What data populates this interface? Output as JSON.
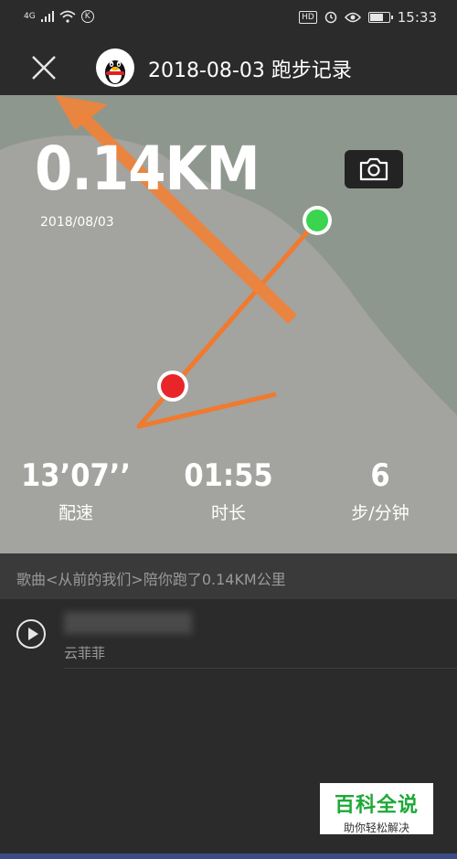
{
  "status": {
    "network": "4G",
    "k_badge": "K",
    "hd": "HD",
    "time": "15:33",
    "battery_level": 0.8
  },
  "nav": {
    "title": "2018-08-03 跑步记录"
  },
  "run": {
    "distance": "0.14KM",
    "date": "2018/08/03",
    "stats": [
      {
        "value": "13’07’’",
        "label": "配速"
      },
      {
        "value": "01:55",
        "label": "时长"
      },
      {
        "value": "6",
        "label": "步/分钟"
      }
    ]
  },
  "song_banner": {
    "text": "歌曲<从前的我们>陪你跑了0.14KM公里"
  },
  "song": {
    "artist": "云菲菲"
  },
  "watermark": {
    "title": "百科全说",
    "subtitle": "助你轻松解决"
  },
  "colors": {
    "map_background": "#a3a39f",
    "route": "#f07a2e",
    "start_point": "#3bd44f",
    "end_point": "#e8262a",
    "brand_green": "#1da838"
  },
  "icons": [
    "close-icon",
    "camera-icon",
    "play-icon",
    "qq-penguin-avatar",
    "signal-icon",
    "wifi-icon",
    "eye-icon",
    "battery-icon"
  ]
}
